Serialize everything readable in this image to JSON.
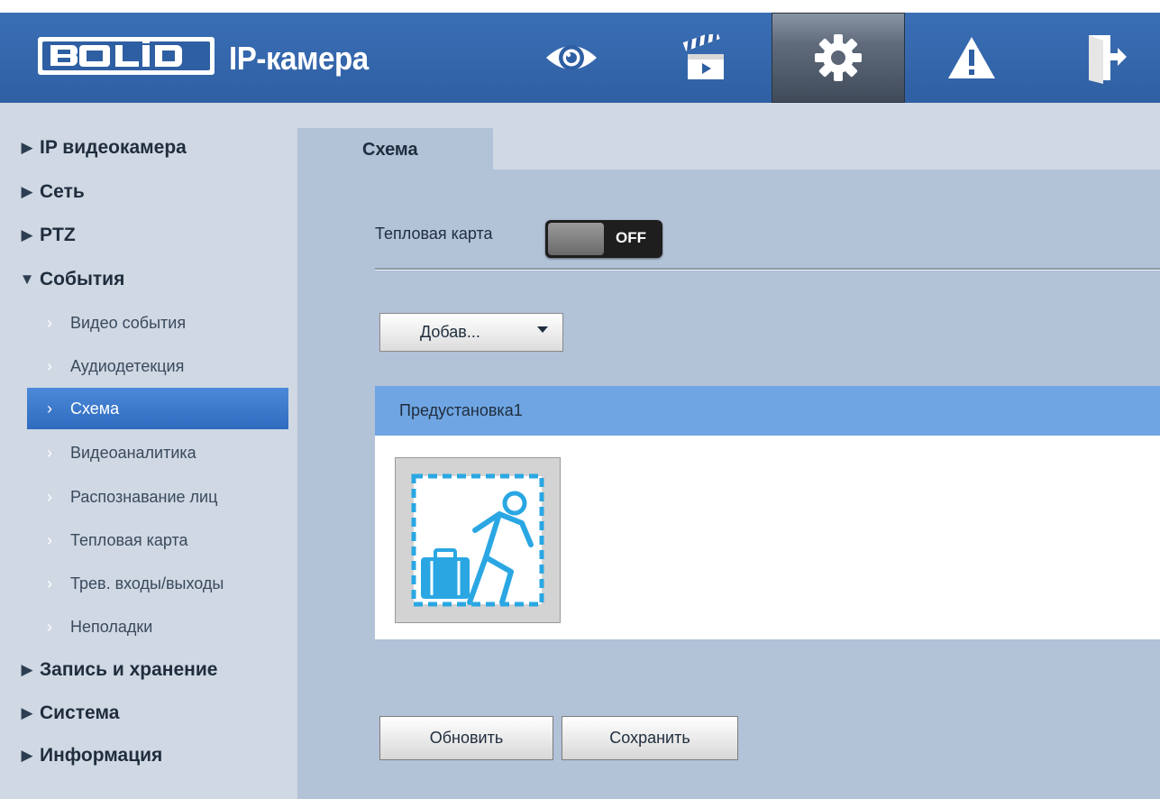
{
  "header": {
    "logo_text": "BOLID",
    "title": "IP-камера",
    "nav": [
      {
        "icon": "eye-icon",
        "label": ""
      },
      {
        "icon": "clapperboard-icon",
        "label": ""
      },
      {
        "icon": "gear-icon",
        "label": ""
      },
      {
        "icon": "warning-icon",
        "label": ""
      },
      {
        "icon": "exit-icon",
        "label": ""
      }
    ],
    "active_nav": "gear-icon",
    "colors": {
      "bar": "#3268b0",
      "active": "#4a5566"
    }
  },
  "sidebar": {
    "items": [
      {
        "label": "IP видеокамера",
        "expanded": false
      },
      {
        "label": "Сеть",
        "expanded": false
      },
      {
        "label": "PTZ",
        "expanded": false
      },
      {
        "label": "События",
        "expanded": true
      },
      {
        "label": "Запись и хранение",
        "expanded": false
      },
      {
        "label": "Система",
        "expanded": false
      },
      {
        "label": "Информация",
        "expanded": false
      }
    ],
    "events_subitems": [
      {
        "label": "Видео события"
      },
      {
        "label": "Аудиодетекция"
      },
      {
        "label": "Схема",
        "active": true
      },
      {
        "label": "Видеоаналитика"
      },
      {
        "label": "Распознавание лиц"
      },
      {
        "label": "Тепловая карта"
      },
      {
        "label": "Трев. входы/выходы"
      },
      {
        "label": "Неполадки"
      }
    ]
  },
  "main": {
    "tab_label": "Схема",
    "heatmap": {
      "label": "Тепловая карта",
      "toggle_state": "OFF"
    },
    "add_dropdown": {
      "label": "Добав..."
    },
    "preset": {
      "title": "Предустановка1",
      "icon": "abandoned-object-icon"
    },
    "buttons": {
      "refresh": "Обновить",
      "save": "Сохранить"
    }
  }
}
